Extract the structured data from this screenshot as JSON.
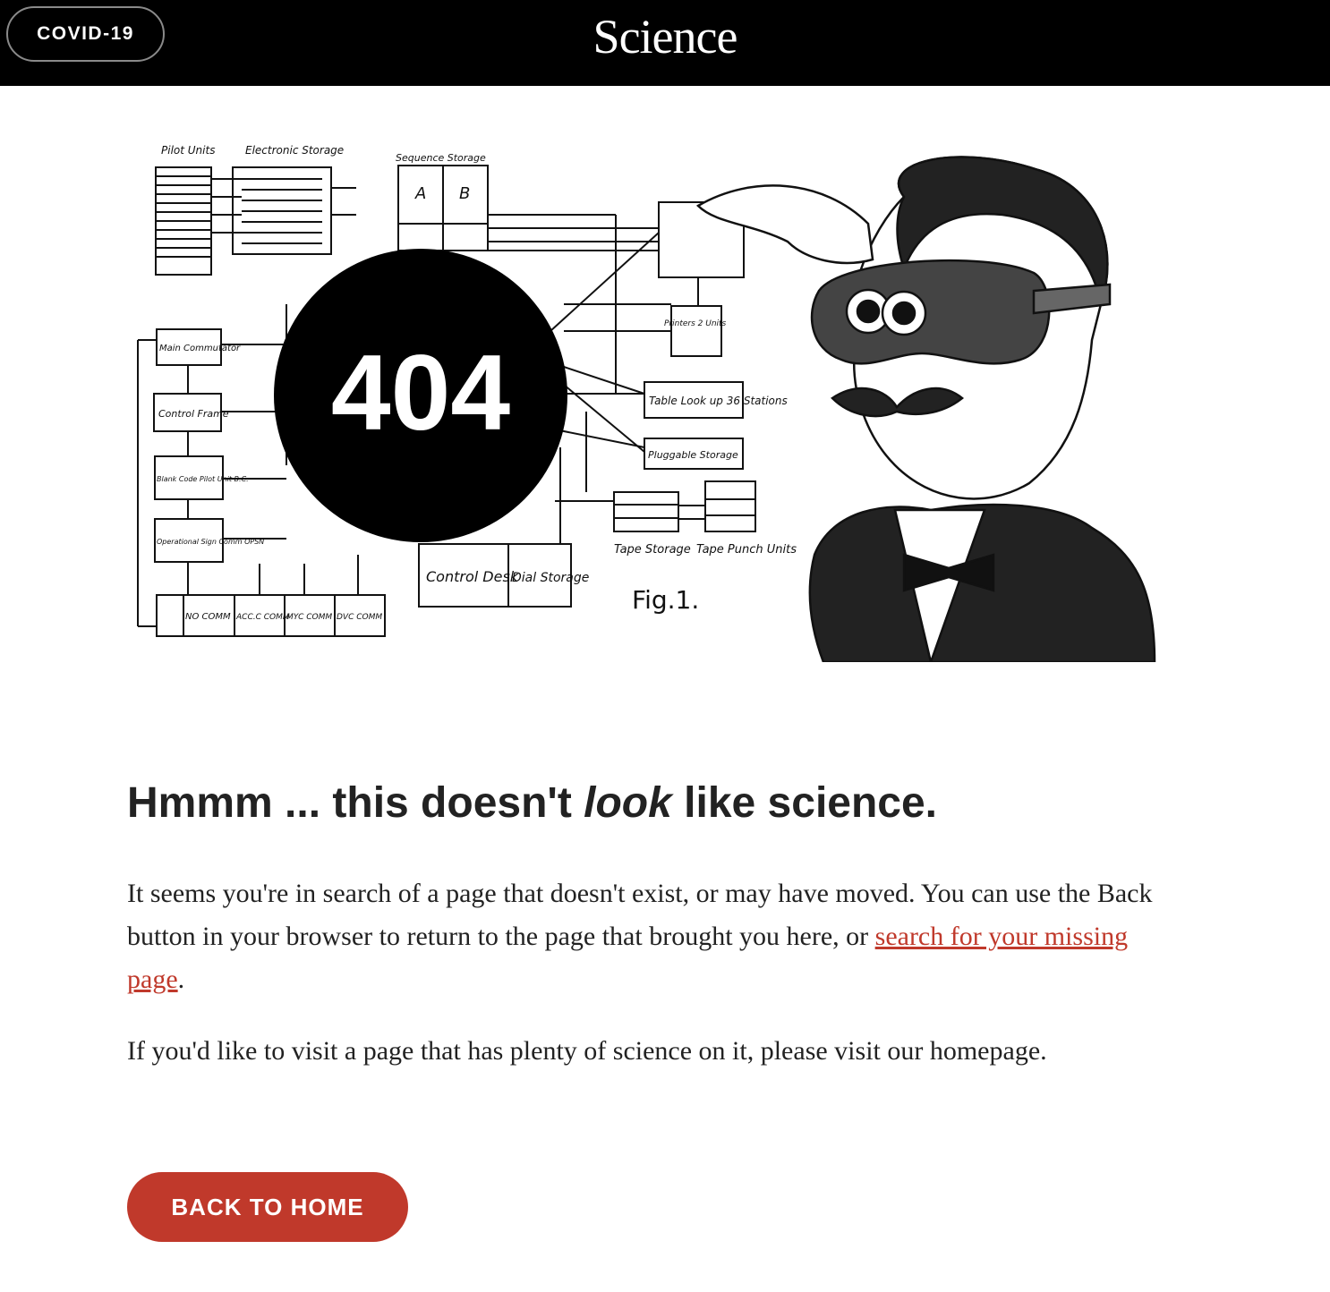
{
  "header": {
    "covid_label": "COVID-19",
    "brand": "Science"
  },
  "illustration": {
    "badge_text": "404",
    "labels": {
      "pilot_units": "Pilot Units",
      "electronic_storage": "Electronic Storage",
      "sequence_storage": "Sequence Storage",
      "seq_a": "A",
      "seq_b": "B",
      "main_commutator": "Main Commutator",
      "control_frame": "Control Frame",
      "blank_code": "Blank Code Pilot Unit B.C.",
      "operational_sign": "Operational Sign Comm OPSN",
      "no_comm": "NO COMM",
      "acc_comm": "ACC.C COMM",
      "myc_comm": "MYC COMM",
      "dvc_comm": "DVC COMM",
      "control_desk": "Control Desk",
      "dial_storage": "Dial Storage",
      "printers": "Printers 2 Units",
      "table_look_up": "Table Look up 36 Stations",
      "pluggable_storage": "Pluggable Storage",
      "tape_storage": "Tape Storage",
      "tape_punch_units": "Tape Punch Units",
      "fig": "Fig.1."
    }
  },
  "content": {
    "headline_before": "Hmmm ... this doesn't ",
    "headline_emphasis": "look",
    "headline_after": " like science.",
    "p1_text": "It seems you're in search of a page that doesn't exist, or may have moved. You can use the Back button in your browser to return to the page that brought you here, or ",
    "p1_link": "search for your missing page",
    "p1_end": ".",
    "p2_text": "If you'd like to visit a page that has plenty of science on it, please visit our homepage."
  },
  "cta": {
    "back_home_label": "BACK TO HOME"
  },
  "colors": {
    "accent": "#c0392b",
    "header_bg": "#000000",
    "text": "#222222"
  }
}
